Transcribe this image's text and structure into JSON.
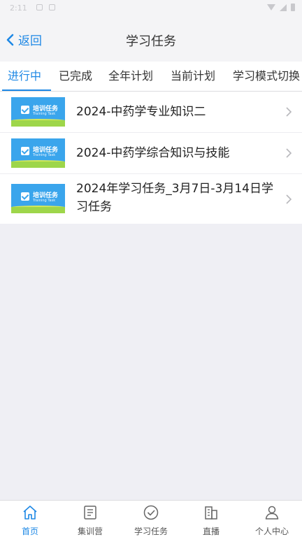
{
  "status_bar": {
    "time": "2:11"
  },
  "header": {
    "back_label": "返回",
    "title": "学习任务"
  },
  "tabs": [
    {
      "label": "进行中",
      "active": true
    },
    {
      "label": "已完成",
      "active": false
    },
    {
      "label": "全年计划",
      "active": false
    },
    {
      "label": "当前计划",
      "active": false
    },
    {
      "label": "学习模式切换",
      "active": false
    }
  ],
  "thumbnail": {
    "title": "培训任务",
    "subtitle": "Training Task"
  },
  "tasks": [
    {
      "title": "2024-中药学专业知识二"
    },
    {
      "title": "2024-中药学综合知识与技能"
    },
    {
      "title": "2024年学习任务_3月7日-3月14日学习任务"
    }
  ],
  "bottom_nav": [
    {
      "label": "首页",
      "icon": "home-icon",
      "active": true
    },
    {
      "label": "集训营",
      "icon": "checklist-icon",
      "active": false
    },
    {
      "label": "学习任务",
      "icon": "check-circle-icon",
      "active": false
    },
    {
      "label": "直播",
      "icon": "building-icon",
      "active": false
    },
    {
      "label": "个人中心",
      "icon": "person-icon",
      "active": false
    }
  ],
  "colors": {
    "accent": "#1e88e5",
    "background": "#efeff4"
  }
}
